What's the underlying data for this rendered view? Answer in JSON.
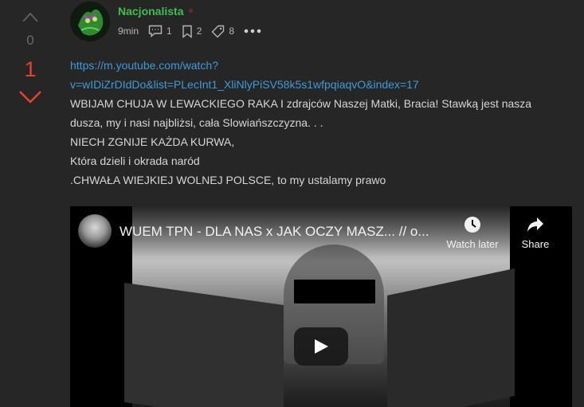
{
  "vote": {
    "neutral_score": "0",
    "user_vote": "1"
  },
  "post": {
    "username": "Nacjonalista",
    "time": "9min",
    "comments_count": "1",
    "saves_count": "2",
    "tags_count": "8",
    "link_line1": "https://m.youtube.com/watch?",
    "link_line2": "v=wIDiZrDIdDo&list=PLecInt1_XliNlyPiSV58k5s1wfpqiaqvO&index=17",
    "body_lines": [
      "WBIJAM CHUJA W LEWACKIEGO RAKA I zdrajców Naszej Matki, Bracia! Stawką jest nasza",
      "dusza, my i nasi najbliżsi, cała Slowiańszczyzna. . .",
      "NIECH ZGNIJE KAŻDA KURWA,",
      "Która dzieli i okrada naród",
      ".CHWAŁA WIEJKIEJ WOLNEJ POLSCE, to my ustalamy prawo"
    ]
  },
  "video": {
    "title": "WUEM TPN - DLA NAS x JAK OCZY MASZ... // o...",
    "watch_later_label": "Watch later",
    "share_label": "Share"
  },
  "colors": {
    "username": "#3fbf4f",
    "link": "#3e9ad8",
    "vote_active": "#e8412c",
    "background": "#262626"
  },
  "icons": [
    "chevron-up-icon",
    "chevron-down-icon",
    "comment-icon",
    "bookmark-icon",
    "tag-icon",
    "more-icon",
    "clock-icon",
    "share-icon",
    "play-icon"
  ]
}
